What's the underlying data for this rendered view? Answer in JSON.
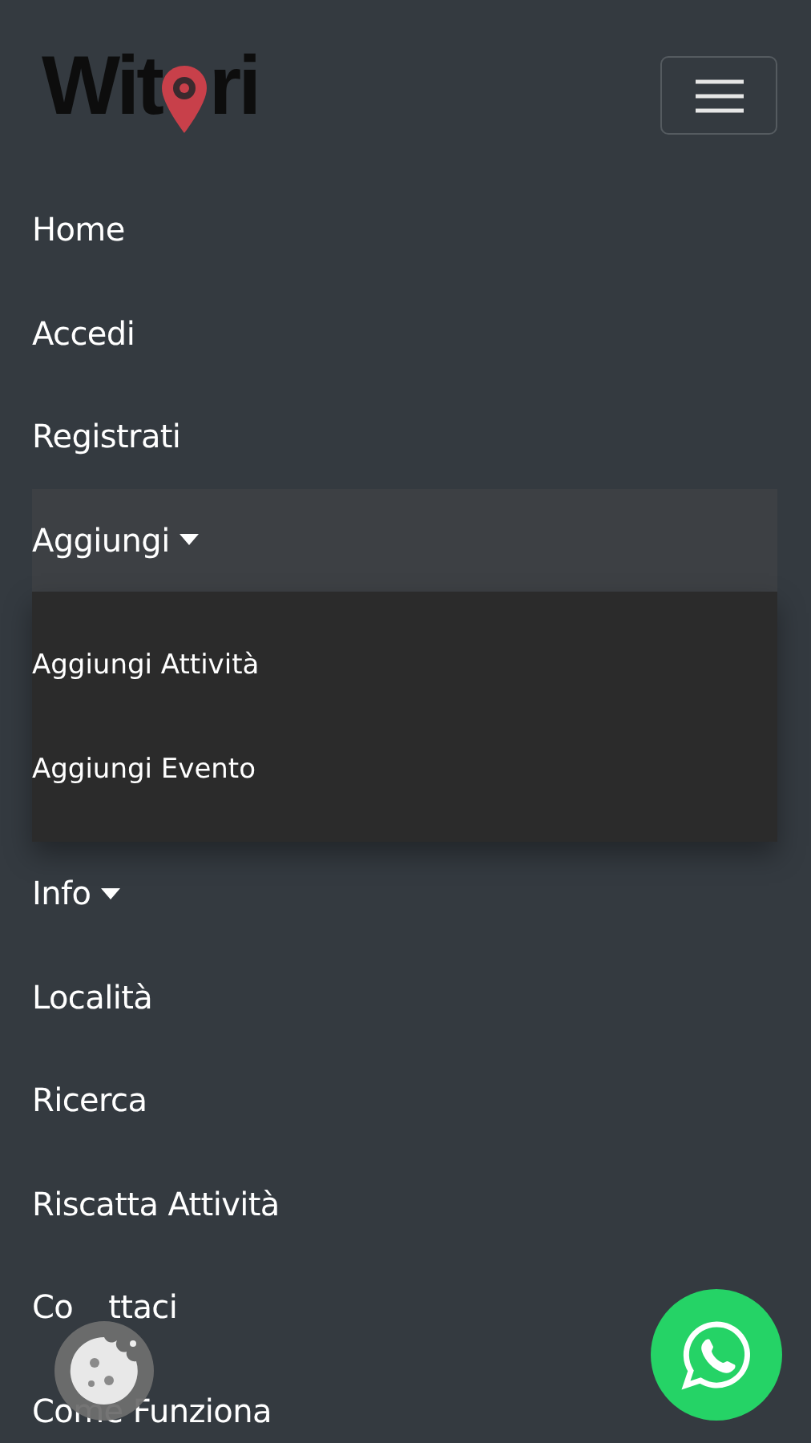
{
  "logo": {
    "before": "Wit",
    "after": "ri"
  },
  "nav": [
    {
      "label": "Home",
      "kind": "link"
    },
    {
      "label": "Accedi",
      "kind": "link"
    },
    {
      "label": "Registrati",
      "kind": "link"
    },
    {
      "label": "Aggiungi",
      "kind": "dropdown",
      "expanded": true,
      "children": [
        {
          "label": "Aggiungi Attività"
        },
        {
          "label": "Aggiungi Evento"
        }
      ]
    },
    {
      "label": "Info",
      "kind": "dropdown",
      "expanded": false
    },
    {
      "label": "Località",
      "kind": "link"
    },
    {
      "label": "Ricerca",
      "kind": "link"
    },
    {
      "label": "Riscatta Attività",
      "kind": "link"
    },
    {
      "parts": [
        "Co",
        "ttaci"
      ],
      "kind": "covered_link"
    },
    {
      "label": "Come Funziona",
      "kind": "link"
    }
  ]
}
